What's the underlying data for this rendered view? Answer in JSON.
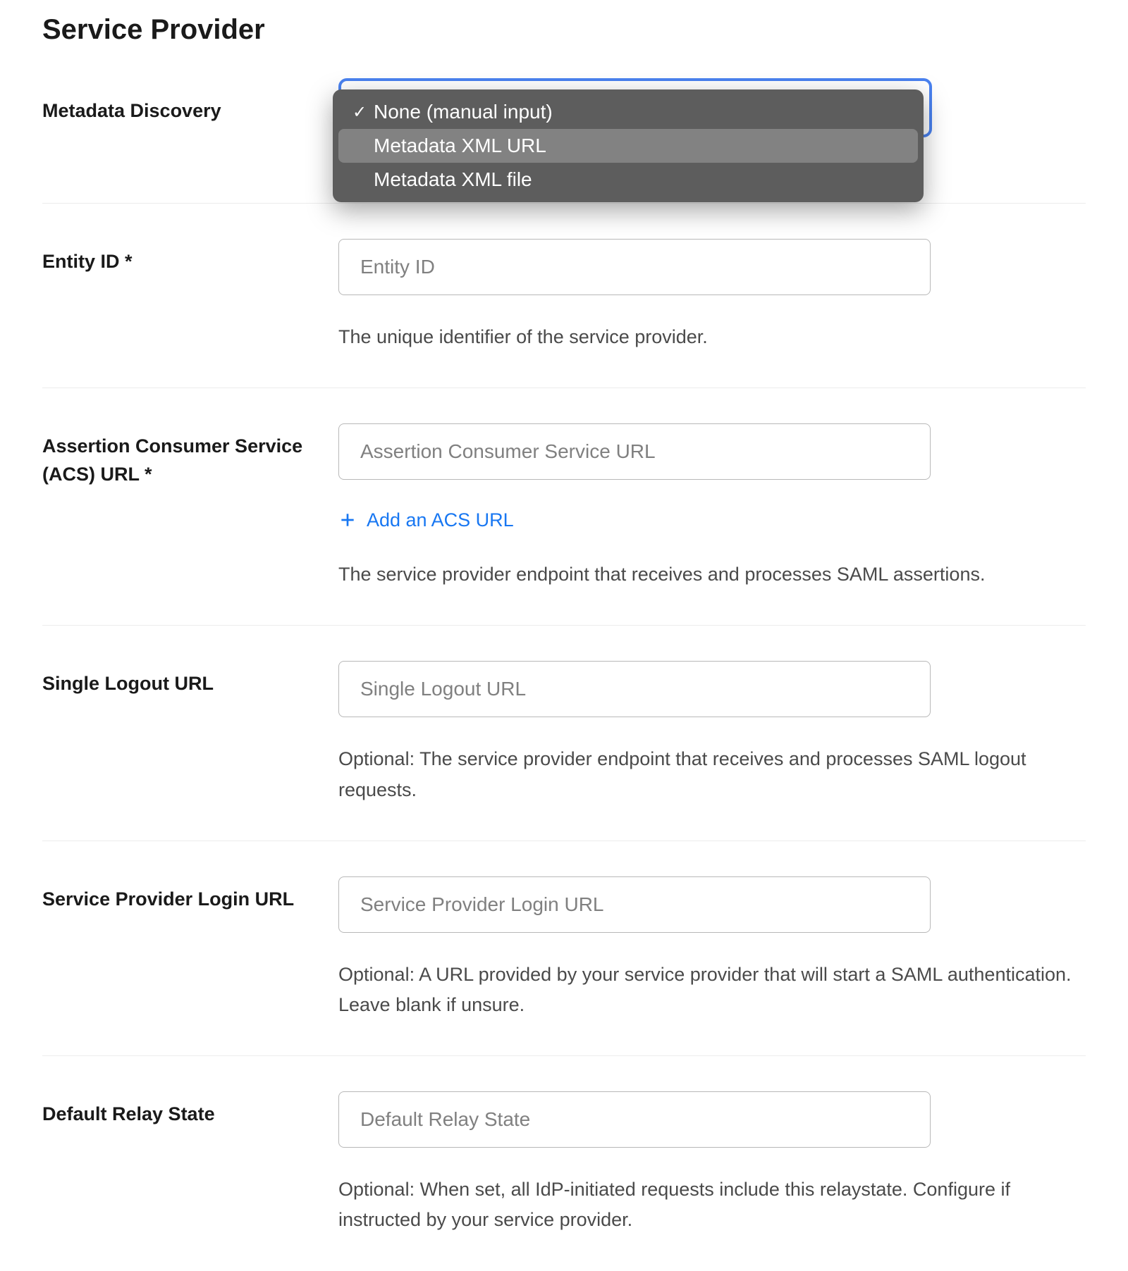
{
  "title": "Service Provider",
  "fields": {
    "metadata_discovery": {
      "label": "Metadata Discovery",
      "options": [
        {
          "label": "None (manual input)",
          "selected": true,
          "highlighted": false
        },
        {
          "label": "Metadata XML URL",
          "selected": false,
          "highlighted": true
        },
        {
          "label": "Metadata XML file",
          "selected": false,
          "highlighted": false
        }
      ]
    },
    "entity_id": {
      "label": "Entity ID *",
      "placeholder": "Entity ID",
      "value": "",
      "help": "The unique identifier of the service provider."
    },
    "acs_url": {
      "label": "Assertion Consumer Service (ACS) URL *",
      "placeholder": "Assertion Consumer Service URL",
      "value": "",
      "add_label": "Add an ACS URL",
      "help": "The service provider endpoint that receives and processes SAML assertions."
    },
    "slo_url": {
      "label": "Single Logout URL",
      "placeholder": "Single Logout URL",
      "value": "",
      "help": "Optional: The service provider endpoint that receives and processes SAML logout requests."
    },
    "sp_login_url": {
      "label": "Service Provider Login URL",
      "placeholder": "Service Provider Login URL",
      "value": "",
      "help": "Optional: A URL provided by your service provider that will start a SAML authentication. Leave blank if unsure."
    },
    "relay_state": {
      "label": "Default Relay State",
      "placeholder": "Default Relay State",
      "value": "",
      "help": "Optional: When set, all IdP-initiated requests include this relaystate. Configure if instructed by your service provider."
    }
  }
}
